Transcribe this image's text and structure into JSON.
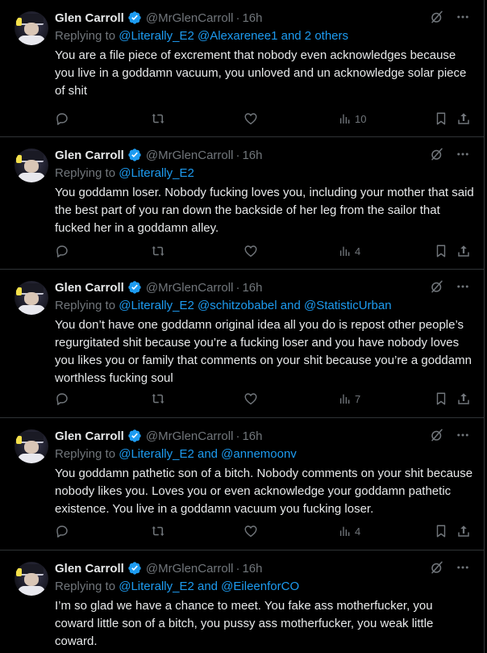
{
  "tweets": [
    {
      "name": "Glen Carroll",
      "handle": "@MrGlenCarroll",
      "time": "16h",
      "replying_label": "Replying to",
      "replying_links": [
        "@Literally_E2 @Alexarenee1 and 2 others"
      ],
      "text": "You are a file piece of excrement that nobody even acknowledges because you live in a goddamn vacuum, you unloved and un acknowledge solar piece of shit",
      "views": "10"
    },
    {
      "name": "Glen Carroll",
      "handle": "@MrGlenCarroll",
      "time": "16h",
      "replying_label": "Replying to",
      "replying_links": [
        "@Literally_E2"
      ],
      "text": "You goddamn loser. Nobody fucking loves you, including your mother that said the best part of you ran down the backside of her leg from the sailor that fucked her in a goddamn alley.",
      "views": "4"
    },
    {
      "name": "Glen Carroll",
      "handle": "@MrGlenCarroll",
      "time": "16h",
      "replying_label": "Replying to",
      "replying_links": [
        "@Literally_E2 @schitzobabel and @StatisticUrban"
      ],
      "text": "You don’t have one goddamn original idea all you do is repost other people’s regurgitated shit because you’re a fucking loser and you have nobody loves you likes you or family that comments on your shit because you’re a goddamn worthless fucking soul",
      "views": "7"
    },
    {
      "name": "Glen Carroll",
      "handle": "@MrGlenCarroll",
      "time": "16h",
      "replying_label": "Replying to",
      "replying_links": [
        "@Literally_E2 and @annemoonv"
      ],
      "text": "You goddamn pathetic son of a bitch. Nobody comments on your shit because nobody likes you. Loves you or even acknowledge your goddamn pathetic existence. You live in a goddamn vacuum you fucking loser.",
      "views": "4"
    },
    {
      "name": "Glen Carroll",
      "handle": "@MrGlenCarroll",
      "time": "16h",
      "replying_label": "Replying to",
      "replying_links": [
        "@Literally_E2 and @EileenforCO"
      ],
      "text": "I’m so glad we have a chance to meet. You fake ass motherfucker, you coward little son of a bitch, you pussy ass motherfucker, you weak little coward.",
      "views": ""
    }
  ],
  "colors": {
    "background": "#000000",
    "text": "#e7e9ea",
    "muted": "#71767b",
    "link": "#1d9bf0",
    "divider": "#2f3336"
  },
  "icons": {
    "verified": "verified-badge-icon",
    "grok": "grok-icon",
    "more": "more-icon",
    "reply": "reply-icon",
    "retweet": "retweet-icon",
    "like": "like-icon",
    "views": "views-icon",
    "bookmark": "bookmark-icon",
    "share": "share-icon"
  }
}
